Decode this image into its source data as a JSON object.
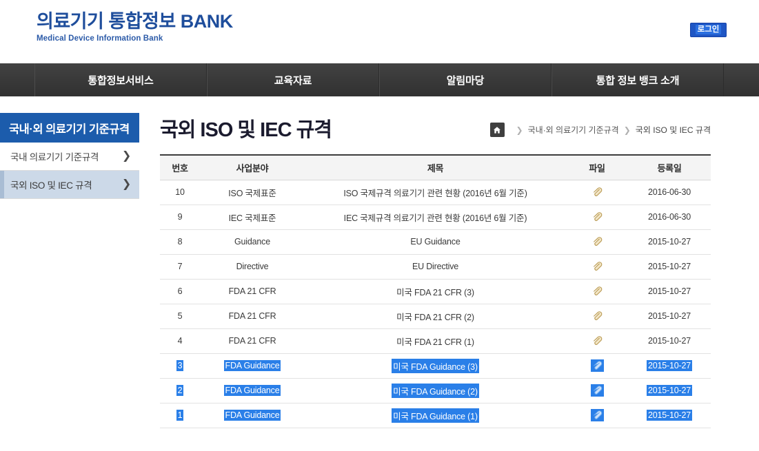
{
  "header": {
    "brand_main": "의료기기 통합정보 BANK",
    "brand_sub": "Medical Device Information Bank",
    "login_label": "로그인",
    "brand_color": "#1f4e9c",
    "login_bg": "#1f56c4"
  },
  "nav": {
    "items": [
      {
        "label": "통합정보서비스"
      },
      {
        "label": "교육자료"
      },
      {
        "label": "알림마당"
      },
      {
        "label": "통합 정보 뱅크 소개"
      }
    ]
  },
  "sidebar": {
    "title": "국내·외 의료기기 기준규격",
    "title_bg": "#1c5cac",
    "items": [
      {
        "label": "국내 의료기기 기준규격",
        "active": false
      },
      {
        "label": "국외 ISO 및 IEC 규격",
        "active": true
      }
    ],
    "chevron": "❯"
  },
  "main": {
    "page_title": "국외 ISO 및 IEC 규격",
    "breadcrumb": {
      "home_icon": "home-icon",
      "separator": "❯",
      "items": [
        {
          "label": "국내·외 의료기기 기준규격",
          "current": false
        },
        {
          "label": "국외 ISO 및 IEC 규격",
          "current": true
        }
      ]
    },
    "table": {
      "columns": [
        {
          "key": "no",
          "label": "번호"
        },
        {
          "key": "field",
          "label": "사업분야"
        },
        {
          "key": "title",
          "label": "제목"
        },
        {
          "key": "file",
          "label": "파일"
        },
        {
          "key": "date",
          "label": "등록일"
        }
      ],
      "file_icon": "paperclip-icon",
      "rows": [
        {
          "no": "10",
          "field": "ISO 국제표준",
          "title": "ISO 국제규격 의료기기 관련 현황 (2016년 6월 기준)",
          "file": "paperclip-icon",
          "date": "2016-06-30",
          "selected": false
        },
        {
          "no": "9",
          "field": "IEC 국제표준",
          "title": "IEC 국제규격 의료기기 관련 현황 (2016년 6월 기준)",
          "file": "paperclip-icon",
          "date": "2016-06-30",
          "selected": false
        },
        {
          "no": "8",
          "field": "Guidance",
          "title": "EU Guidance",
          "file": "paperclip-icon",
          "date": "2015-10-27",
          "selected": false
        },
        {
          "no": "7",
          "field": "Directive",
          "title": "EU Directive",
          "file": "paperclip-icon",
          "date": "2015-10-27",
          "selected": false
        },
        {
          "no": "6",
          "field": "FDA 21 CFR",
          "title": "미국 FDA 21 CFR (3)",
          "file": "paperclip-icon",
          "date": "2015-10-27",
          "selected": false
        },
        {
          "no": "5",
          "field": "FDA 21 CFR",
          "title": "미국 FDA 21 CFR (2)",
          "file": "paperclip-icon",
          "date": "2015-10-27",
          "selected": false
        },
        {
          "no": "4",
          "field": "FDA 21 CFR",
          "title": "미국 FDA 21 CFR (1)",
          "file": "paperclip-icon",
          "date": "2015-10-27",
          "selected": false
        },
        {
          "no": "3",
          "field": "FDA Guidance",
          "title": "미국 FDA Guidance (3)",
          "file": "paperclip-icon",
          "date": "2015-10-27",
          "selected": true
        },
        {
          "no": "2",
          "field": "FDA Guidance",
          "title": "미국 FDA Guidance (2)",
          "file": "paperclip-icon",
          "date": "2015-10-27",
          "selected": true
        },
        {
          "no": "1",
          "field": "FDA Guidance",
          "title": "미국 FDA Guidance (1)",
          "file": "paperclip-icon",
          "date": "2015-10-27",
          "selected": true
        }
      ]
    }
  }
}
